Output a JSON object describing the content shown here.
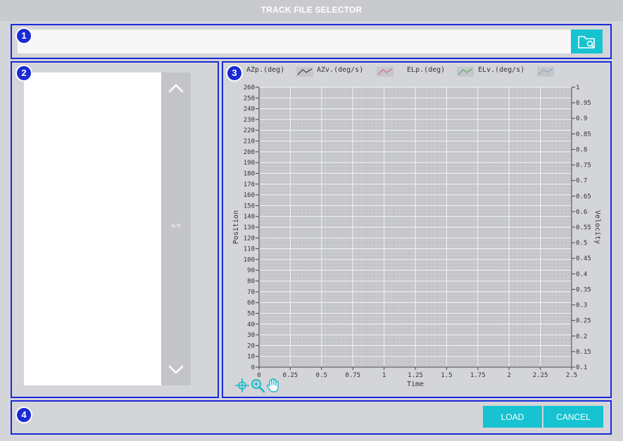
{
  "window": {
    "title": "TRACK FILE SELECTOR"
  },
  "badges": [
    "1",
    "2",
    "3",
    "4"
  ],
  "path_bar": {
    "value": "",
    "placeholder": "",
    "browse_icon": "folder-search-icon"
  },
  "file_list": {
    "page_count": "0/0",
    "scroll_up_icon": "chevron-up-icon",
    "scroll_down_icon": "chevron-down-icon"
  },
  "legend": [
    {
      "label": "AZp.(deg)",
      "color": "#333333"
    },
    {
      "label": "AZv.(deg/s)",
      "color": "#e06070"
    },
    {
      "label": "ELp.(deg)",
      "color": "#4caf50"
    },
    {
      "label": "ELv.(deg/s)",
      "color": "#7fa8c8"
    }
  ],
  "chart_data": {
    "type": "line",
    "xlabel": "Time",
    "ylabel": "Position",
    "y2label": "Velocity",
    "x_ticks": [
      "0",
      "0.25",
      "0.5",
      "0.75",
      "1",
      "1.25",
      "1.5",
      "1.75",
      "2",
      "2.25",
      "2.5"
    ],
    "y_ticks": [
      "0",
      "10",
      "20",
      "30",
      "40",
      "50",
      "60",
      "70",
      "80",
      "90",
      "100",
      "110",
      "120",
      "130",
      "140",
      "150",
      "160",
      "170",
      "180",
      "190",
      "200",
      "210",
      "220",
      "230",
      "240",
      "250",
      "260"
    ],
    "y2_ticks": [
      "0.1",
      "0.15",
      "0.2",
      "0.25",
      "0.3",
      "0.35",
      "0.4",
      "0.45",
      "0.5",
      "0.55",
      "0.6",
      "0.65",
      "0.7",
      "0.75",
      "0.8",
      "0.85",
      "0.9",
      "0.95",
      "1"
    ],
    "xlim": [
      0,
      2.5
    ],
    "ylim": [
      0,
      260
    ],
    "y2lim": [
      0.1,
      1
    ],
    "grid": true,
    "series": [],
    "legend_position": "top"
  },
  "chart_tools": [
    "crosshair-icon",
    "zoom-icon",
    "pan-hand-icon"
  ],
  "actions": {
    "load_label": "LOAD",
    "cancel_label": "CANCEL"
  }
}
